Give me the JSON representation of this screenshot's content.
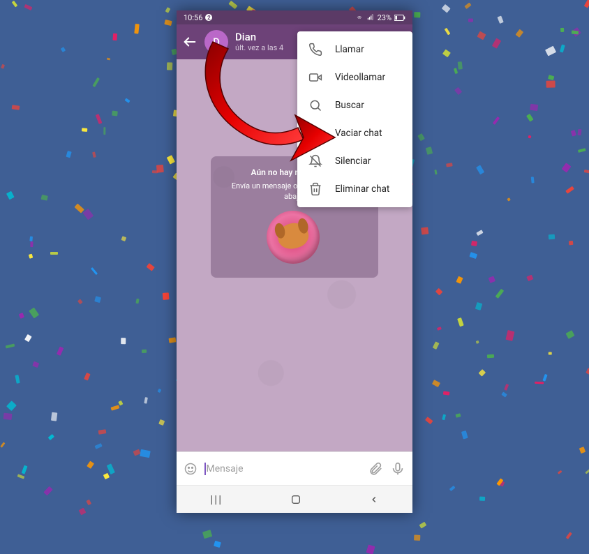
{
  "statusbar": {
    "time": "10:56",
    "badge": "2",
    "battery": "23%"
  },
  "header": {
    "avatar_letter": "D",
    "name": "Dian",
    "last_seen": "últ. vez a las 4"
  },
  "menu": {
    "call": "Llamar",
    "videocall": "Videollamar",
    "search": "Buscar",
    "clear": "Vaciar chat",
    "mute": "Silenciar",
    "delete": "Eliminar chat"
  },
  "empty": {
    "title": "Aún no hay mensajes...",
    "subtitle": "Envía un mensaje o toca el saludo de abajo."
  },
  "input": {
    "placeholder": "Mensaje"
  }
}
